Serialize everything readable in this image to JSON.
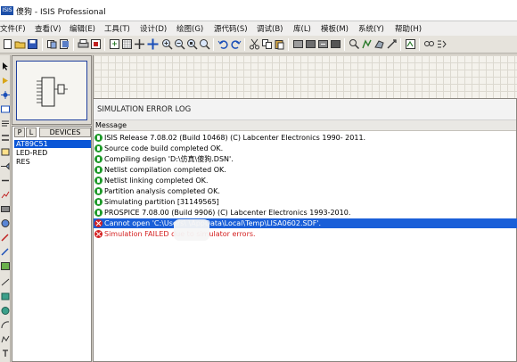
{
  "window": {
    "app_icon_text": "ISIS",
    "title": "傻狗 - ISIS Professional"
  },
  "menu": [
    "文件(F)",
    "查看(V)",
    "编辑(E)",
    "工具(T)",
    "设计(D)",
    "绘图(G)",
    "源代码(S)",
    "调试(B)",
    "库(L)",
    "模板(M)",
    "系统(Y)",
    "帮助(H)"
  ],
  "toolbar": {
    "icons": [
      "new-icon",
      "open-icon",
      "save-icon",
      "import-icon",
      "export-icon",
      "print-icon",
      "area-icon",
      "refresh-icon",
      "grid-icon",
      "origin-icon",
      "pan-icon",
      "zoom-in-icon",
      "zoom-out-icon",
      "zoom-all-icon",
      "zoom-area-icon",
      "undo-icon",
      "redo-icon",
      "cut-icon",
      "copy-icon",
      "paste-icon",
      "block-copy-icon",
      "block-move-icon",
      "block-rotate-icon",
      "block-delete-icon",
      "pick-device-icon",
      "make-device-icon",
      "packaging-icon",
      "decompose-icon",
      "wire-autorouter-icon",
      "search-tag-icon",
      "property-assign-icon"
    ]
  },
  "devices": {
    "tab_p": "P",
    "tab_l": "L",
    "header": "DEVICES",
    "items": [
      "AT89C51",
      "LED-RED",
      "RES"
    ],
    "selected_index": 0
  },
  "dialog": {
    "title": "SIMULATION ERROR LOG",
    "column": "Message",
    "messages": [
      {
        "type": "ok",
        "text": "ISIS Release 7.08.02 (Build 10468) (C) Labcenter Electronics 1990- 2011."
      },
      {
        "type": "ok",
        "text": "Source code build completed OK."
      },
      {
        "type": "ok",
        "text": "Compiling design 'D:\\仿真\\傻狗.DSN'."
      },
      {
        "type": "ok",
        "text": "Netlist compilation completed OK."
      },
      {
        "type": "ok",
        "text": "Netlist linking completed OK."
      },
      {
        "type": "ok",
        "text": "Partition analysis completed OK."
      },
      {
        "type": "ok",
        "text": "Simulating partition [31149565]"
      },
      {
        "type": "ok",
        "text": "PROSPICE 7.08.00 (Build 9906) (C) Labcenter Electronics 1993-2010."
      },
      {
        "type": "error",
        "text": "Cannot open 'C:\\Users\\        \\AppData\\Local\\Temp\\LISA0602.SDF'.",
        "selected": true
      },
      {
        "type": "error",
        "text": "Simulation FAILED due to simulator errors.",
        "selected": false
      }
    ]
  }
}
